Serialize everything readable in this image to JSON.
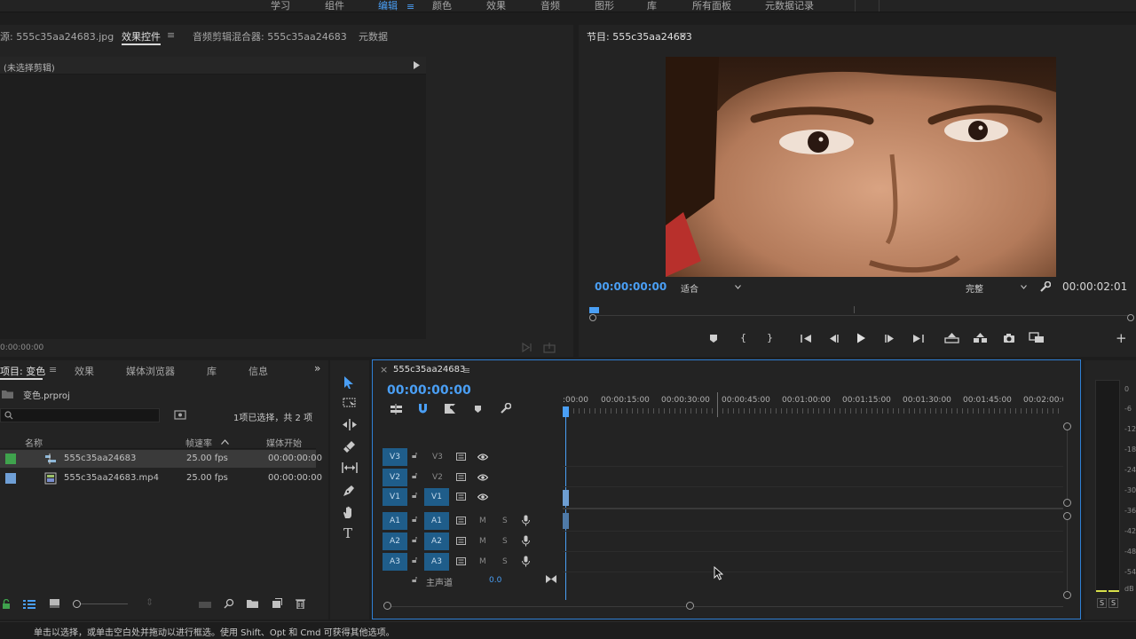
{
  "workspaces": [
    "学习",
    "组件",
    "编辑",
    "颜色",
    "效果",
    "音频",
    "图形",
    "库",
    "所有面板",
    "元数据记录"
  ],
  "workspace_active": "编辑",
  "workspace_menu_glyph": "≡",
  "source_panel": {
    "tabs": [
      "源: 555c35aa24683.jpg",
      "效果控件",
      "音频剪辑混合器: 555c35aa24683",
      "元数据"
    ],
    "active_tab": "效果控件",
    "no_clip_text": "(未选择剪辑)",
    "timecode": "0:00:00:00"
  },
  "program_monitor": {
    "title": "节目: 555c35aa24683",
    "timecode_left": "00:00:00:00",
    "fit_select": "适合",
    "quality_select": "完整",
    "timecode_right": "00:00:02:01"
  },
  "project_panel": {
    "tabs": [
      "项目: 变色",
      "效果",
      "媒体浏览器",
      "库",
      "信息"
    ],
    "active_tab": "项目: 变色",
    "project_file": "变色.prproj",
    "search_placeholder": "",
    "selection_status": "1项已选择，共 2 项",
    "columns": [
      "名称",
      "帧速率",
      "媒体开始"
    ],
    "items": [
      {
        "name": "555c35aa24683",
        "fps": "25.00 fps",
        "start": "00:00:00:00",
        "color": "#3fa34d",
        "kind": "sequence",
        "selected": true
      },
      {
        "name": "555c35aa24683.mp4",
        "fps": "25.00 fps",
        "start": "00:00:00:00",
        "color": "#6f9fd6",
        "kind": "video",
        "selected": false
      }
    ]
  },
  "timeline": {
    "sequence_name": "555c35aa24683",
    "timecode": "00:00:00:00",
    "ruler_labels": [
      ":00:00",
      "00:00:15:00",
      "00:00:30:00",
      "00:00:45:00",
      "00:01:00:00",
      "00:01:15:00",
      "00:01:30:00",
      "00:01:45:00",
      "00:02:00:0"
    ],
    "video_tracks": [
      {
        "left": "V3",
        "name": "V3"
      },
      {
        "left": "V2",
        "name": "V2"
      },
      {
        "left": "V1",
        "name": "V1"
      }
    ],
    "audio_tracks": [
      {
        "left": "A1",
        "name": "A1",
        "m": "M",
        "s": "S"
      },
      {
        "left": "A2",
        "name": "A2",
        "m": "M",
        "s": "S"
      },
      {
        "left": "A3",
        "name": "A3",
        "m": "M",
        "s": "S"
      }
    ],
    "master_label": "主声道",
    "master_value": "0.0"
  },
  "audio_meter": {
    "scale": [
      "0",
      "-6",
      "-12",
      "-18",
      "-24",
      "-30",
      "-36",
      "-42",
      "-48",
      "-54",
      "dB"
    ],
    "solo_labels": [
      "S",
      "S"
    ]
  },
  "status_bar": "单击以选择，或单击空白处并拖动以进行框选。使用 Shift、Opt 和 Cmd 可获得其他选项。",
  "colors": {
    "accent": "#4a9ff5",
    "track_button": "#1f5d8a",
    "panel_border_active": "#2f7fd4"
  }
}
